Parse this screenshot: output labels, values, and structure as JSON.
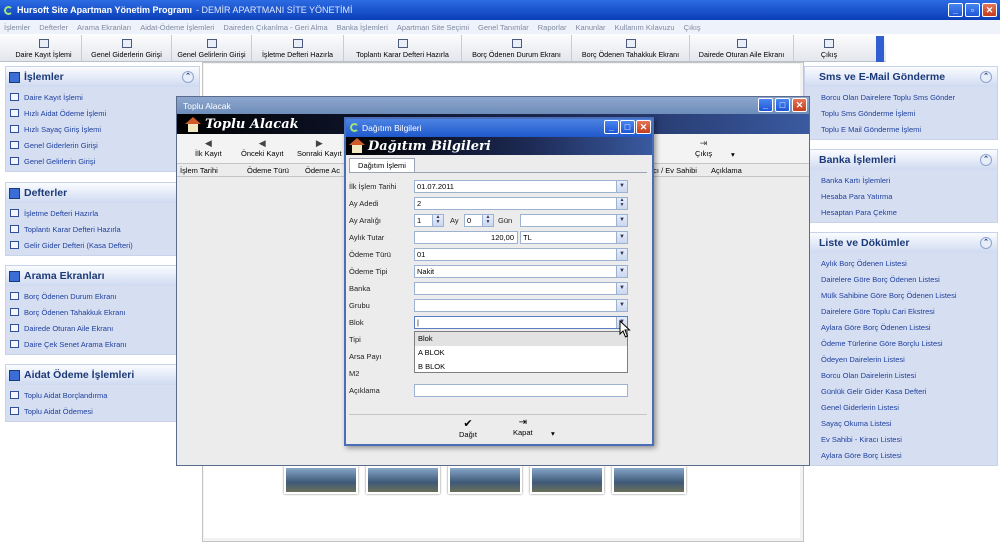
{
  "app": {
    "title": "Hursoft Site Apartman Yönetim Programı",
    "subtitle": "- DEMİR APARTMANI SİTE YÖNETİMİ"
  },
  "menu": [
    "İşlemler",
    "Defterler",
    "Arama Ekranları",
    "Aidat-Ödeme İşlemleri",
    "Daireden Çıkarılma - Geri Alma",
    "Banka İşlemleri",
    "Apartman Site Seçimi",
    "Genel Tanımlar",
    "Raporlar",
    "Kanunlar",
    "Kullanım Kılavuzu",
    "Çıkış"
  ],
  "toolbar": [
    "Daire Kayıt İşlemi",
    "Genel Giderlerin Girişi",
    "Genel Gelirlerin Girişi",
    "İşletme Defteri Hazırla",
    "Toplantı Karar Defteri Hazırla",
    "Borç Ödenen Durum Ekranı",
    "Borç Ödenen Tahakkuk Ekranı",
    "Dairede Oturan Aile Ekranı",
    "Çıkış"
  ],
  "left": {
    "groups": [
      {
        "title": "İşlemler",
        "items": [
          "Daire Kayıt İşlemi",
          "Hızlı Aidat Ödeme İşlemi",
          "Hızlı Sayaç Giriş İşlemi",
          "Genel Giderlerin Girişi",
          "Genel Gelirlerin Girişi"
        ]
      },
      {
        "title": "Defterler",
        "items": [
          "İşletme Defteri Hazırla",
          "Toplantı Karar Defteri Hazırla",
          "Gelir Gider Defteri (Kasa Defteri)"
        ]
      },
      {
        "title": "Arama Ekranları",
        "items": [
          "Borç Ödenen Durum Ekranı",
          "Borç Ödenen Tahakkuk Ekranı",
          "Dairede Oturan Aile Ekranı",
          "Daire Çek Senet Arama Ekranı"
        ]
      },
      {
        "title": "Aidat Ödeme İşlemleri",
        "items": [
          "Toplu Aidat Borçlandırma",
          "Toplu Aidat Ödemesi"
        ]
      }
    ]
  },
  "right": {
    "groups": [
      {
        "title": "Sms ve E-Mail Gönderme",
        "items": [
          "Borcu Olan Dairelere Toplu Sms Gönder",
          "Toplu Sms Gönderme İşlemi",
          "Toplu E Mail Gönderme İşlemi"
        ]
      },
      {
        "title": "Banka İşlemleri",
        "items": [
          "Banka Kartı İşlemleri",
          "Hesaba Para Yatırma",
          "Hesaptan Para Çekme"
        ]
      },
      {
        "title": "Liste ve Dökümler",
        "items": [
          "Aylık Borç Ödenen Listesi",
          "Dairelere Göre Borç Ödenen Listesi",
          "Mülk Sahibine Göre Borç Ödenen Listesi",
          "Dairelere Göre Toplu Cari Ekstresi",
          "Aylara Göre Borç Ödenen Listesi",
          "Ödeme Türlerine Göre Borçlu Listesi",
          "Ödeyen Dairelerin Listesi",
          "Borcu Olan Dairelerin Listesi",
          "Günlük Gelir Gider Kasa Defteri",
          "Genel Giderlerin Listesi",
          "Sayaç Okuma Listesi",
          "Ev Sahibi - Kiracı Listesi",
          "Aylara Göre Borç Listesi"
        ]
      }
    ]
  },
  "toplu": {
    "title": "Toplu Alacak",
    "banner": "Toplu Alacak",
    "nav": [
      "İlk Kayıt",
      "Önceki Kayıt",
      "Sonraki Kayıt",
      "Çıkış"
    ],
    "columns": [
      "İşlem Tarihi",
      "Ödeme Türü",
      "Ödeme Ac",
      "acı / Ev Sahibi",
      "Açıklama"
    ]
  },
  "dagitim": {
    "title": "Dağıtım Bilgileri",
    "banner": "Dağıtım Bilgileri",
    "tab": "Dağıtım İşlemi",
    "labels": {
      "ilk_islem_tarihi": "İlk İşlem Tarihi",
      "ay_adedi": "Ay Adedi",
      "ay_araligi": "Ay Aralığı",
      "aylik_tutar": "Aylık Tutar",
      "odeme_turu": "Ödeme Türü",
      "odeme_tipi": "Ödeme Tipi",
      "banka": "Banka",
      "grubu": "Grubu",
      "blok": "Blok",
      "tipi": "Tipi",
      "arsa_payi": "Arsa Payı",
      "m2": "M2",
      "aciklama": "Açıklama",
      "ay": "Ay",
      "gun": "Gün"
    },
    "values": {
      "ilk_islem_tarihi": "01.07.2011",
      "ay_adedi": "2",
      "ay_araligi": "1",
      "ay": "0",
      "aylik_tutar": "120,00",
      "currency": "TL",
      "odeme_turu": "01",
      "odeme_tipi": "Nakit",
      "banka": "",
      "grubu": "",
      "blok": "",
      "aciklama": ""
    },
    "blok_options": [
      "Blok",
      "A BLOK",
      "B BLOK"
    ],
    "buttons": {
      "dagit": "Dağıt",
      "kapat": "Kapat"
    }
  },
  "colors": {
    "accent": "#1f58cc",
    "link": "#1e3f9e",
    "panel": "#d6dff2"
  }
}
